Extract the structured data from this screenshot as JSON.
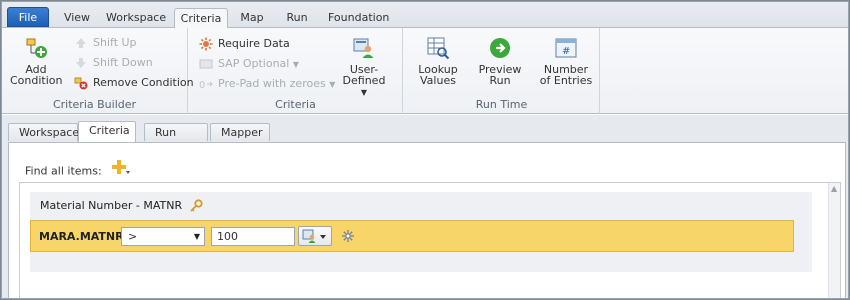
{
  "menu": {
    "file": "File",
    "tabs": [
      "View",
      "Workspace",
      "Criteria",
      "Map",
      "Run",
      "Foundation"
    ],
    "active_tab": "Criteria"
  },
  "ribbon": {
    "criteria_builder": {
      "label": "Criteria Builder",
      "add_condition": "Add Condition",
      "add_condition_line1": "Add",
      "add_condition_line2": "Condition",
      "shift_up": "Shift Up",
      "shift_down": "Shift Down",
      "remove_condition": "Remove Condition"
    },
    "criteria": {
      "label": "Criteria",
      "require_data": "Require Data",
      "sap_optional": "SAP Optional",
      "pre_pad": "Pre-Pad with zeroes",
      "user_defined": "User-Defined"
    },
    "run_time": {
      "label": "Run Time",
      "lookup_line1": "Lookup",
      "lookup_line2": "Values",
      "preview_line1": "Preview",
      "preview_line2": "Run",
      "number_line1": "Number",
      "number_line2": "of Entries"
    }
  },
  "workspace": {
    "tabs": [
      "Workspace",
      "Criteria",
      "Run Time",
      "Mapper"
    ],
    "active_tab": "Criteria",
    "find_all_items": "Find all items:",
    "field": {
      "title": "Material Number - MATNR",
      "condition_label": "MARA.MATNR",
      "operator": ">",
      "value": "100"
    }
  },
  "colors": {
    "file_tab": "#1f5fb7",
    "condition_row": "#f8d568",
    "accent_green": "#3aa83a"
  }
}
